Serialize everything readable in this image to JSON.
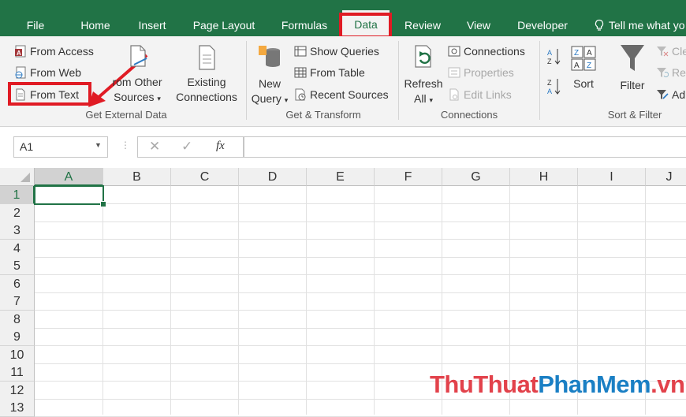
{
  "tabs": [
    {
      "label": "File",
      "active": false
    },
    {
      "label": "Home",
      "active": false
    },
    {
      "label": "Insert",
      "active": false
    },
    {
      "label": "Page Layout",
      "active": false
    },
    {
      "label": "Formulas",
      "active": false
    },
    {
      "label": "Data",
      "active": true
    },
    {
      "label": "Review",
      "active": false
    },
    {
      "label": "View",
      "active": false
    },
    {
      "label": "Developer",
      "active": false
    }
  ],
  "tell_me": "Tell me what yo",
  "ribbon": {
    "get_external_data": {
      "label": "Get External Data",
      "from_access": "From Access",
      "from_web": "From Web",
      "from_text": "From Text",
      "from_other_line1": "rom Other",
      "from_other_line2": "Sources",
      "existing_line1": "Existing",
      "existing_line2": "Connections"
    },
    "get_transform": {
      "label": "Get & Transform",
      "new_query_line1": "New",
      "new_query_line2": "Query",
      "show_queries": "Show Queries",
      "from_table": "From Table",
      "recent_sources": "Recent Sources"
    },
    "connections": {
      "label": "Connections",
      "refresh_line1": "Refresh",
      "refresh_line2": "All",
      "connections": "Connections",
      "properties": "Properties",
      "edit_links": "Edit Links"
    },
    "sort_filter": {
      "label": "Sort & Filter",
      "sort": "Sort",
      "filter": "Filter",
      "clear": "Cle",
      "reapply": "Re",
      "advanced": "Ad"
    }
  },
  "formula_bar": {
    "name_box": "A1",
    "fx_label": "fx",
    "value": ""
  },
  "grid": {
    "columns": [
      "A",
      "B",
      "C",
      "D",
      "E",
      "F",
      "G",
      "H",
      "I",
      "J"
    ],
    "rows": [
      "1",
      "2",
      "3",
      "4",
      "5",
      "6",
      "7",
      "8",
      "9",
      "10",
      "11",
      "12",
      "13"
    ],
    "active_cell": "A1"
  },
  "watermark": {
    "part1": "ThuThuat",
    "part2": "PhanMem",
    "part3": ".vn"
  },
  "colors": {
    "accent": "#217346",
    "highlight": "#e01b24"
  }
}
